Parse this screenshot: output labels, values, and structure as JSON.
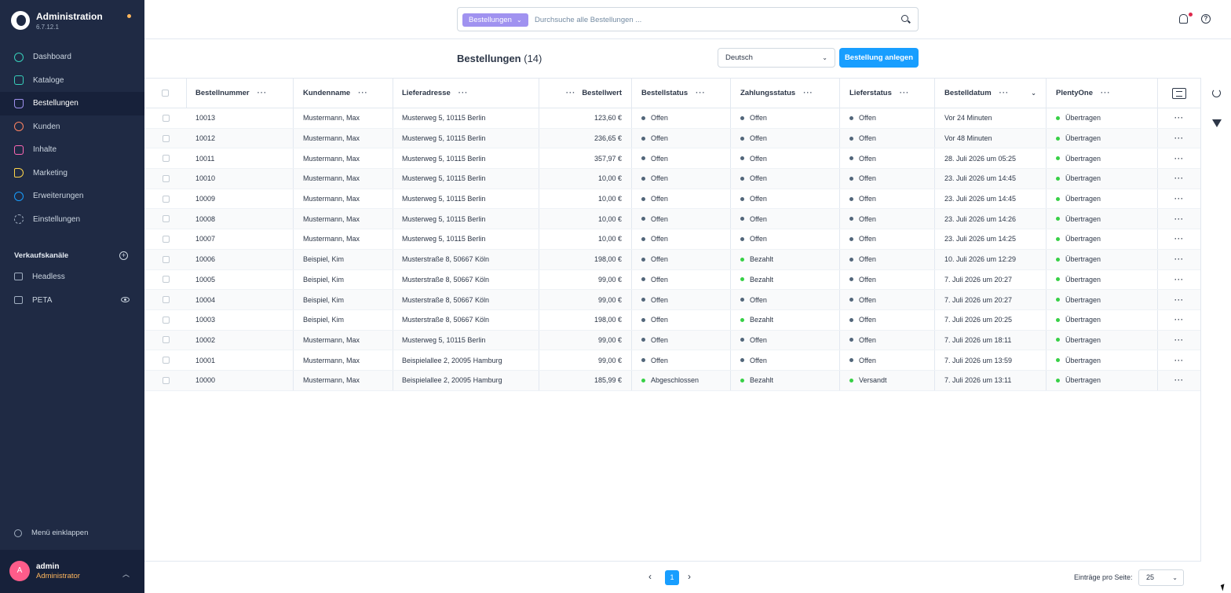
{
  "app": {
    "title": "Administration",
    "version": "6.7.12.1"
  },
  "nav": [
    {
      "label": "Dashboard",
      "icon": "dashboard-icon"
    },
    {
      "label": "Kataloge",
      "icon": "catalog-icon"
    },
    {
      "label": "Bestellungen",
      "icon": "orders-bag-icon",
      "active": true
    },
    {
      "label": "Kunden",
      "icon": "customers-icon"
    },
    {
      "label": "Inhalte",
      "icon": "content-icon"
    },
    {
      "label": "Marketing",
      "icon": "megaphone-icon"
    },
    {
      "label": "Erweiterungen",
      "icon": "extensions-icon"
    },
    {
      "label": "Einstellungen",
      "icon": "settings-gear-icon"
    }
  ],
  "channels": {
    "title": "Verkaufskanäle",
    "items": [
      {
        "label": "Headless"
      },
      {
        "label": "PETA"
      }
    ]
  },
  "collapse_label": "Menü einklappen",
  "user": {
    "initial": "A",
    "name": "admin",
    "role": "Administrator"
  },
  "search": {
    "type_label": "Bestellungen",
    "placeholder": "Durchsuche alle Bestellungen ..."
  },
  "page": {
    "title": "Bestellungen",
    "count": "(14)",
    "language": "Deutsch",
    "create_label": "Bestellung anlegen"
  },
  "table": {
    "headers": {
      "number": "Bestellnummer",
      "customer": "Kundenname",
      "address": "Lieferadresse",
      "amount": "Bestellwert",
      "order_status": "Bestellstatus",
      "payment_status": "Zahlungsstatus",
      "delivery_status": "Lieferstatus",
      "date": "Bestelldatum",
      "plenty": "PlentyOne"
    },
    "rows": [
      {
        "number": "10013",
        "customer": "Mustermann, Max",
        "address": "Musterweg 5, 10115 Berlin",
        "amount": "123,60 €",
        "order_status": "Offen",
        "payment_status": "Offen",
        "delivery_status": "Offen",
        "date": "Vor 24 Minuten",
        "plenty": "Übertragen"
      },
      {
        "number": "10012",
        "customer": "Mustermann, Max",
        "address": "Musterweg 5, 10115 Berlin",
        "amount": "236,65 €",
        "order_status": "Offen",
        "payment_status": "Offen",
        "delivery_status": "Offen",
        "date": "Vor 48 Minuten",
        "plenty": "Übertragen"
      },
      {
        "number": "10011",
        "customer": "Mustermann, Max",
        "address": "Musterweg 5, 10115 Berlin",
        "amount": "357,97 €",
        "order_status": "Offen",
        "payment_status": "Offen",
        "delivery_status": "Offen",
        "date": "28. Juli 2026 um 05:25",
        "plenty": "Übertragen"
      },
      {
        "number": "10010",
        "customer": "Mustermann, Max",
        "address": "Musterweg 5, 10115 Berlin",
        "amount": "10,00 €",
        "order_status": "Offen",
        "payment_status": "Offen",
        "delivery_status": "Offen",
        "date": "23. Juli 2026 um 14:45",
        "plenty": "Übertragen"
      },
      {
        "number": "10009",
        "customer": "Mustermann, Max",
        "address": "Musterweg 5, 10115 Berlin",
        "amount": "10,00 €",
        "order_status": "Offen",
        "payment_status": "Offen",
        "delivery_status": "Offen",
        "date": "23. Juli 2026 um 14:45",
        "plenty": "Übertragen"
      },
      {
        "number": "10008",
        "customer": "Mustermann, Max",
        "address": "Musterweg 5, 10115 Berlin",
        "amount": "10,00 €",
        "order_status": "Offen",
        "payment_status": "Offen",
        "delivery_status": "Offen",
        "date": "23. Juli 2026 um 14:26",
        "plenty": "Übertragen"
      },
      {
        "number": "10007",
        "customer": "Mustermann, Max",
        "address": "Musterweg 5, 10115 Berlin",
        "amount": "10,00 €",
        "order_status": "Offen",
        "payment_status": "Offen",
        "delivery_status": "Offen",
        "date": "23. Juli 2026 um 14:25",
        "plenty": "Übertragen"
      },
      {
        "number": "10006",
        "customer": "Beispiel, Kim",
        "address": "Musterstraße 8, 50667 Köln",
        "amount": "198,00 €",
        "order_status": "Offen",
        "payment_status": "Bezahlt",
        "delivery_status": "Offen",
        "date": "10. Juli 2026 um 12:29",
        "plenty": "Übertragen"
      },
      {
        "number": "10005",
        "customer": "Beispiel, Kim",
        "address": "Musterstraße 8, 50667 Köln",
        "amount": "99,00 €",
        "order_status": "Offen",
        "payment_status": "Bezahlt",
        "delivery_status": "Offen",
        "date": "7. Juli 2026 um 20:27",
        "plenty": "Übertragen"
      },
      {
        "number": "10004",
        "customer": "Beispiel, Kim",
        "address": "Musterstraße 8, 50667 Köln",
        "amount": "99,00 €",
        "order_status": "Offen",
        "payment_status": "Offen",
        "delivery_status": "Offen",
        "date": "7. Juli 2026 um 20:27",
        "plenty": "Übertragen"
      },
      {
        "number": "10003",
        "customer": "Beispiel, Kim",
        "address": "Musterstraße 8, 50667 Köln",
        "amount": "198,00 €",
        "order_status": "Offen",
        "payment_status": "Bezahlt",
        "delivery_status": "Offen",
        "date": "7. Juli 2026 um 20:25",
        "plenty": "Übertragen"
      },
      {
        "number": "10002",
        "customer": "Mustermann, Max",
        "address": "Musterweg 5, 10115 Berlin",
        "amount": "99,00 €",
        "order_status": "Offen",
        "payment_status": "Offen",
        "delivery_status": "Offen",
        "date": "7. Juli 2026 um 18:11",
        "plenty": "Übertragen"
      },
      {
        "number": "10001",
        "customer": "Mustermann, Max",
        "address": "Beispielallee 2, 20095 Hamburg",
        "amount": "99,00 €",
        "order_status": "Offen",
        "payment_status": "Offen",
        "delivery_status": "Offen",
        "date": "7. Juli 2026 um 13:59",
        "plenty": "Übertragen"
      },
      {
        "number": "10000",
        "customer": "Mustermann, Max",
        "address": "Beispielallee 2, 20095 Hamburg",
        "amount": "185,99 €",
        "order_status": "Abgeschlossen",
        "payment_status": "Bezahlt",
        "delivery_status": "Versandt",
        "date": "7. Juli 2026 um 13:11",
        "plenty": "Übertragen"
      }
    ]
  },
  "pagination": {
    "current_page": "1",
    "per_page_label": "Einträge pro Seite:",
    "per_page": "25"
  },
  "colors": {
    "sidebar_bg": "#1f2a44",
    "primary": "#189eff",
    "search_type_bg": "#a092f0",
    "status_green": "#37d046",
    "status_neutral": "#52667a",
    "role_orange": "#ffb75d"
  }
}
